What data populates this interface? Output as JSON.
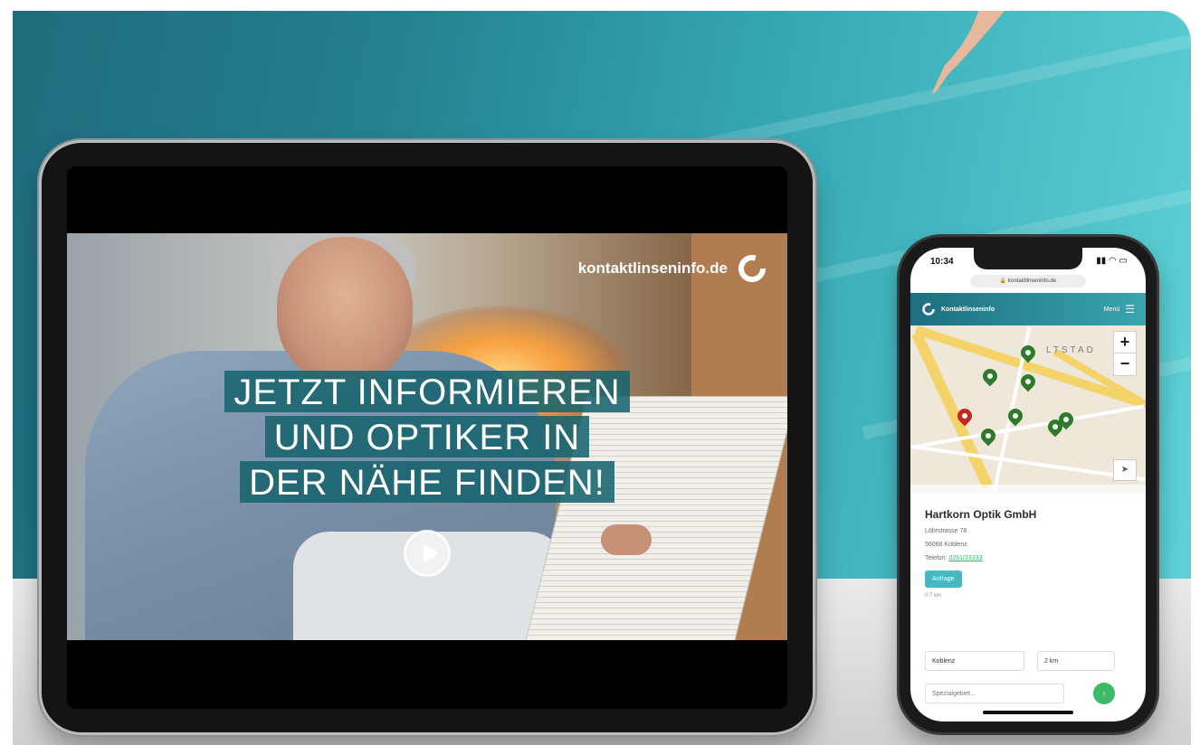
{
  "tablet": {
    "brand": "kontaktlinseninfo.de",
    "headline_lines": [
      "JETZT INFORMIEREN",
      "UND OPTIKER IN",
      "DER NÄHE FINDEN!"
    ]
  },
  "phone": {
    "status_time": "10:34",
    "url": "kontaktlinseninfo.de",
    "app_title": "Kontaktlinseninfo",
    "menu_label": "Menü",
    "map": {
      "district_label": "LTSTAD",
      "zoom_in": "+",
      "zoom_out": "−"
    },
    "result": {
      "name": "Hartkorn Optik GmbH",
      "street": "Löhrstrasse 78",
      "city": "56068 Koblenz",
      "phone_label": "Telefon:",
      "phone": "0261/33333",
      "button": "Anfrage",
      "distance": "0.7 km"
    },
    "search": {
      "city": "Koblenz",
      "radius": "2 km",
      "specialty_placeholder": "Spezialgebiet..."
    }
  },
  "colors": {
    "accent": "#17646e",
    "pin_green": "#2e7a2a",
    "pin_red": "#c3271f",
    "link_green": "#3bb36a"
  }
}
